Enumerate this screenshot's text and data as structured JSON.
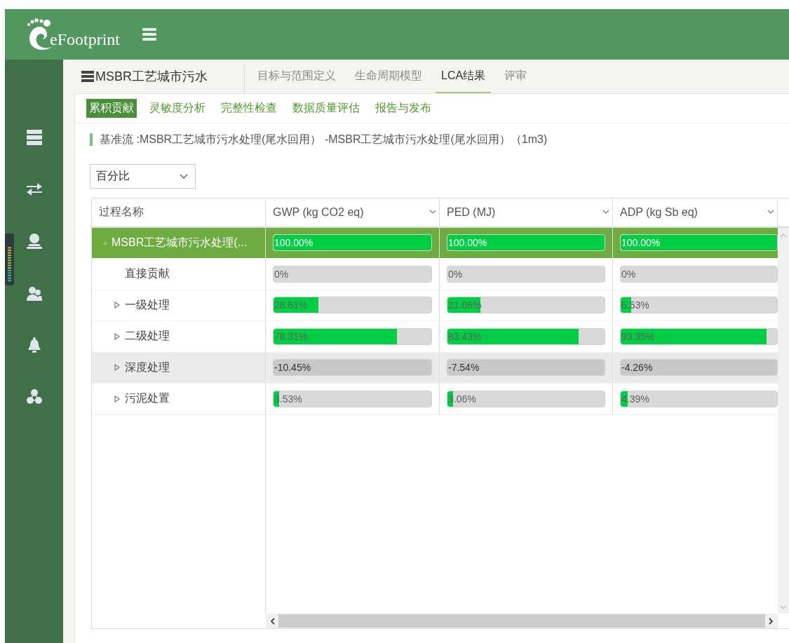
{
  "header": {
    "logo_text": "eFootprint"
  },
  "project": {
    "title": "MSBR工艺城市污水"
  },
  "tabs": [
    {
      "label": "目标与范围定义",
      "selected": false
    },
    {
      "label": "生命周期模型",
      "selected": false
    },
    {
      "label": "LCA结果",
      "selected": true
    },
    {
      "label": "评审",
      "selected": false
    }
  ],
  "subtabs": [
    {
      "label": "累积贡献",
      "selected": true
    },
    {
      "label": "灵敏度分析",
      "selected": false
    },
    {
      "label": "完整性检查",
      "selected": false
    },
    {
      "label": "数据质量评估",
      "selected": false
    },
    {
      "label": "报告与发布",
      "selected": false
    }
  ],
  "basis": {
    "text": "基准流 :MSBR工艺城市污水处理(尾水回用） -MSBR工艺城市污水处理(尾水回用）（1m3)"
  },
  "display_mode": {
    "value": "百分比"
  },
  "table": {
    "name_header": "过程名称",
    "columns": [
      {
        "label": "GWP (kg CO2 eq)"
      },
      {
        "label": "PED (MJ)"
      },
      {
        "label": "ADP (kg Sb eq)"
      }
    ],
    "rows": [
      {
        "name": "MSBR工艺城市污水处理(...",
        "expanded": true,
        "selected": true,
        "cells": [
          {
            "text": "100.00%",
            "level": 1
          },
          {
            "text": "100.00%",
            "level": 1
          },
          {
            "text": "100.00%",
            "level": 1
          }
        ],
        "children": [
          {
            "name": "直接贡献",
            "selected": false,
            "highlighted": false,
            "cells": [
              {
                "text": "0%"
              },
              {
                "text": "0%"
              },
              {
                "text": "0%"
              }
            ]
          },
          {
            "name": "一级处理",
            "expanded": false,
            "selected": false,
            "highlighted": false,
            "cells": [
              {
                "text": "28.61%",
                "level": 0.2861
              },
              {
                "text": "21.06%",
                "level": 0.2106
              },
              {
                "text": "6.53%",
                "level": 0.0653
              }
            ]
          },
          {
            "name": "二级处理",
            "expanded": false,
            "selected": false,
            "highlighted": false,
            "cells": [
              {
                "text": "78.31%",
                "level": 0.7831
              },
              {
                "text": "83.43%",
                "level": 0.8343
              },
              {
                "text": "93.35%",
                "level": 0.9335
              }
            ]
          },
          {
            "name": "深度处理",
            "expanded": false,
            "selected": false,
            "highlighted": true,
            "cells": [
              {
                "text": "-10.45%"
              },
              {
                "text": "-7.54%"
              },
              {
                "text": "-4.26%"
              }
            ]
          },
          {
            "name": "污泥处置",
            "expanded": false,
            "selected": false,
            "highlighted": false,
            "cells": [
              {
                "text": "3.53%",
                "level": 0.0353
              },
              {
                "text": "3.06%",
                "level": 0.0306
              },
              {
                "text": "4.39%",
                "level": 0.0439
              }
            ]
          }
        ]
      }
    ]
  }
}
